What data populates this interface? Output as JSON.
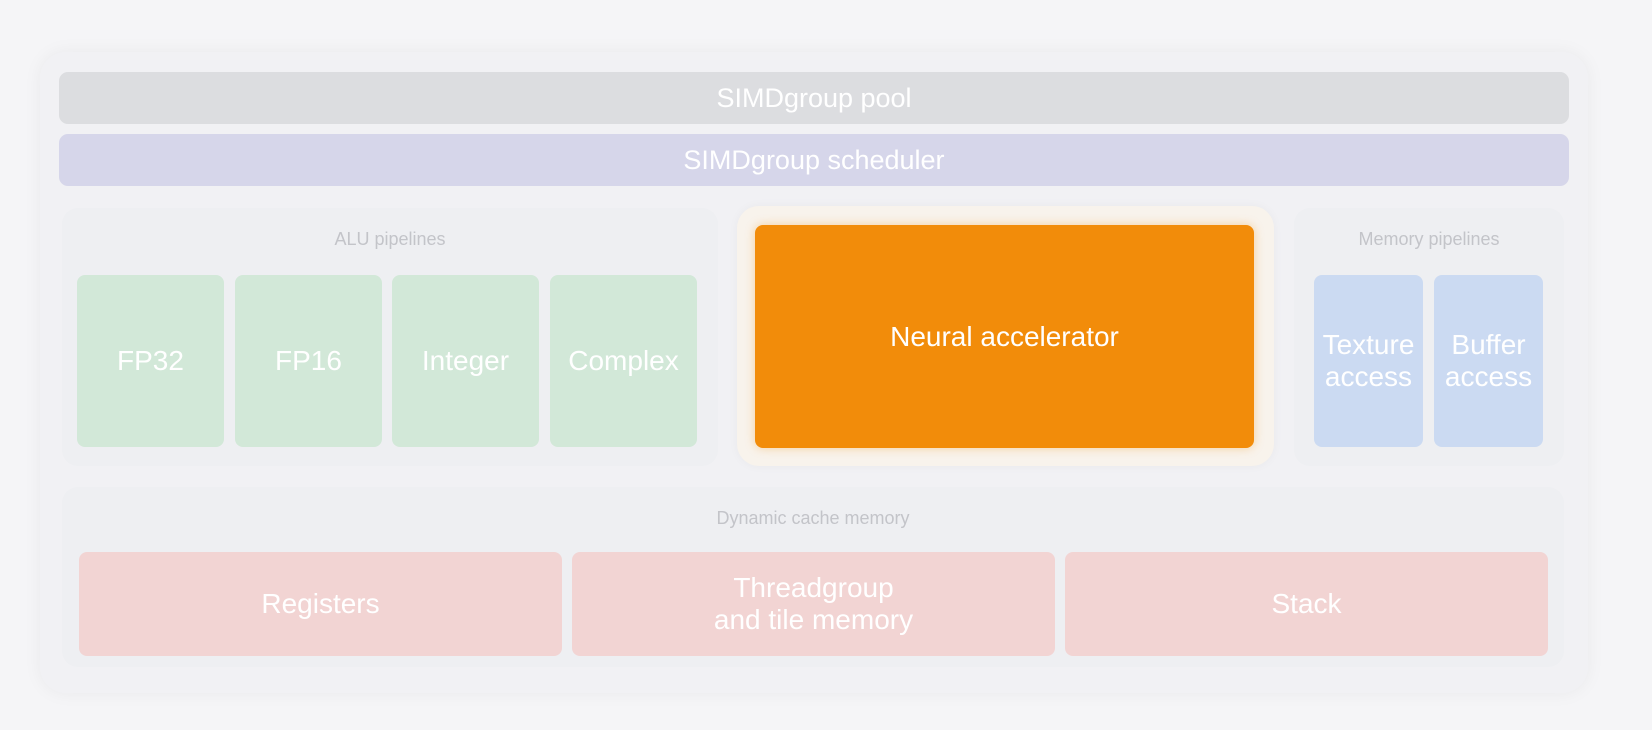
{
  "colors": {
    "pool": "#dcdde0",
    "scheduler": "#d6d6ea",
    "alu": "#d2e8d8",
    "memory": "#cbdaf2",
    "cache": "#f2d4d3",
    "neural": "#f28c0a"
  },
  "top": {
    "pool_label": "SIMDgroup pool",
    "scheduler_label": "SIMDgroup scheduler"
  },
  "alu": {
    "title": "ALU pipelines",
    "units": [
      "FP32",
      "FP16",
      "Integer",
      "Complex"
    ]
  },
  "neural": {
    "label": "Neural accelerator"
  },
  "memory": {
    "title": "Memory pipelines",
    "units": [
      "Texture\naccess",
      "Buffer\naccess"
    ]
  },
  "cache": {
    "title": "Dynamic cache memory",
    "units": [
      "Registers",
      "Threadgroup\nand tile memory",
      "Stack"
    ]
  }
}
